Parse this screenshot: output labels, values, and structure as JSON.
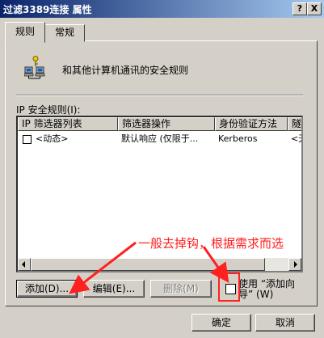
{
  "window": {
    "title": "过滤3389连接 属性",
    "help_button": "?",
    "close_button": "X"
  },
  "tabs": [
    {
      "label": "规则",
      "active": true
    },
    {
      "label": "常规",
      "active": false
    }
  ],
  "header": {
    "text": "和其他计算机通讯的安全规则",
    "icon": "network-computers-key-icon"
  },
  "rules_list": {
    "label": "IP 安全规则(I):",
    "columns": [
      "IP 筛选器列表",
      "筛选器操作",
      "身份验证方法",
      "隧"
    ],
    "rows": [
      {
        "checked": false,
        "filter_list": "<动态>",
        "filter_action": "默认响应 (仅限于...",
        "auth_method": "Kerberos",
        "tunnel": "<无"
      }
    ]
  },
  "buttons": {
    "add": "添加(D)...",
    "edit": "编辑(E)...",
    "remove": "删除(M)",
    "ok": "确定",
    "cancel": "取消"
  },
  "wizard": {
    "line1": "使用 “添加向",
    "line2": "导” (W)",
    "checked": false
  },
  "annotation": {
    "text": "一般去掉钩，根据需求而选",
    "color": "#ff2020"
  }
}
